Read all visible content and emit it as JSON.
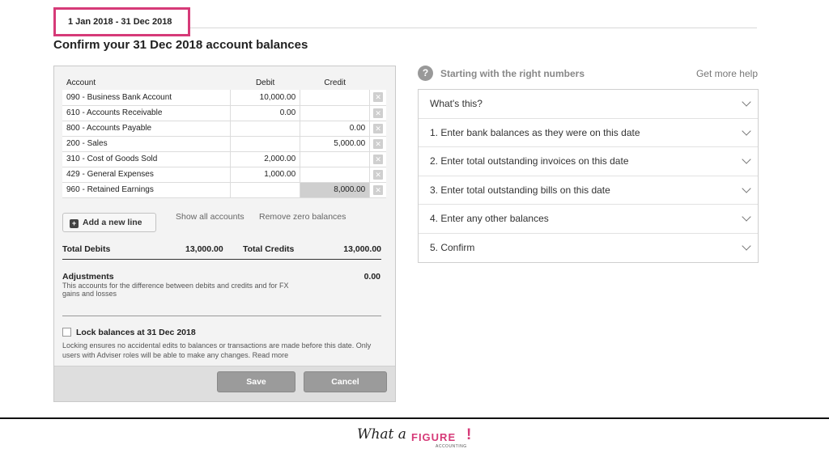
{
  "date_range": "1 Jan 2018 - 31 Dec 2018",
  "page_title": "Confirm your 31 Dec 2018 account balances",
  "table": {
    "headers": {
      "account": "Account",
      "debit": "Debit",
      "credit": "Credit"
    },
    "rows": [
      {
        "account": "090 - Business Bank Account",
        "debit": "10,000.00",
        "credit": ""
      },
      {
        "account": "610 - Accounts Receivable",
        "debit": "0.00",
        "credit": ""
      },
      {
        "account": "800 - Accounts Payable",
        "debit": "",
        "credit": "0.00"
      },
      {
        "account": "200 - Sales",
        "debit": "",
        "credit": "5,000.00"
      },
      {
        "account": "310 - Cost of Goods Sold",
        "debit": "2,000.00",
        "credit": ""
      },
      {
        "account": "429 - General Expenses",
        "debit": "1,000.00",
        "credit": ""
      },
      {
        "account": "960 - Retained Earnings",
        "debit": "",
        "credit": "8,000.00"
      }
    ]
  },
  "actions": {
    "add_line": "Add a new line",
    "show_all": "Show all accounts",
    "remove_zero": "Remove zero balances"
  },
  "totals": {
    "debits_label": "Total Debits",
    "debits_value": "13,000.00",
    "credits_label": "Total Credits",
    "credits_value": "13,000.00"
  },
  "adjustments": {
    "title": "Adjustments",
    "value": "0.00",
    "description": "This accounts for the difference between debits and credits and for FX gains and losses"
  },
  "lock": {
    "label": "Lock balances at 31 Dec 2018",
    "description": "Locking ensures no accidental edits to balances or transactions are made before this date. Only users with Adviser roles will be able to make any changes. Read more"
  },
  "buttons": {
    "save": "Save",
    "cancel": "Cancel"
  },
  "help": {
    "icon": "?",
    "title": "Starting with the right numbers",
    "link": "Get more help",
    "items": [
      "What's this?",
      "1. Enter bank balances as they were on this date",
      "2. Enter total outstanding invoices on this date",
      "3. Enter total outstanding bills on this date",
      "4. Enter any other balances",
      "5. Confirm"
    ]
  },
  "brand": {
    "script": "What a",
    "figure": "FIGURE",
    "bang": "!",
    "sub": "ACCOUNTING",
    "accent_color": "#d63a78"
  }
}
